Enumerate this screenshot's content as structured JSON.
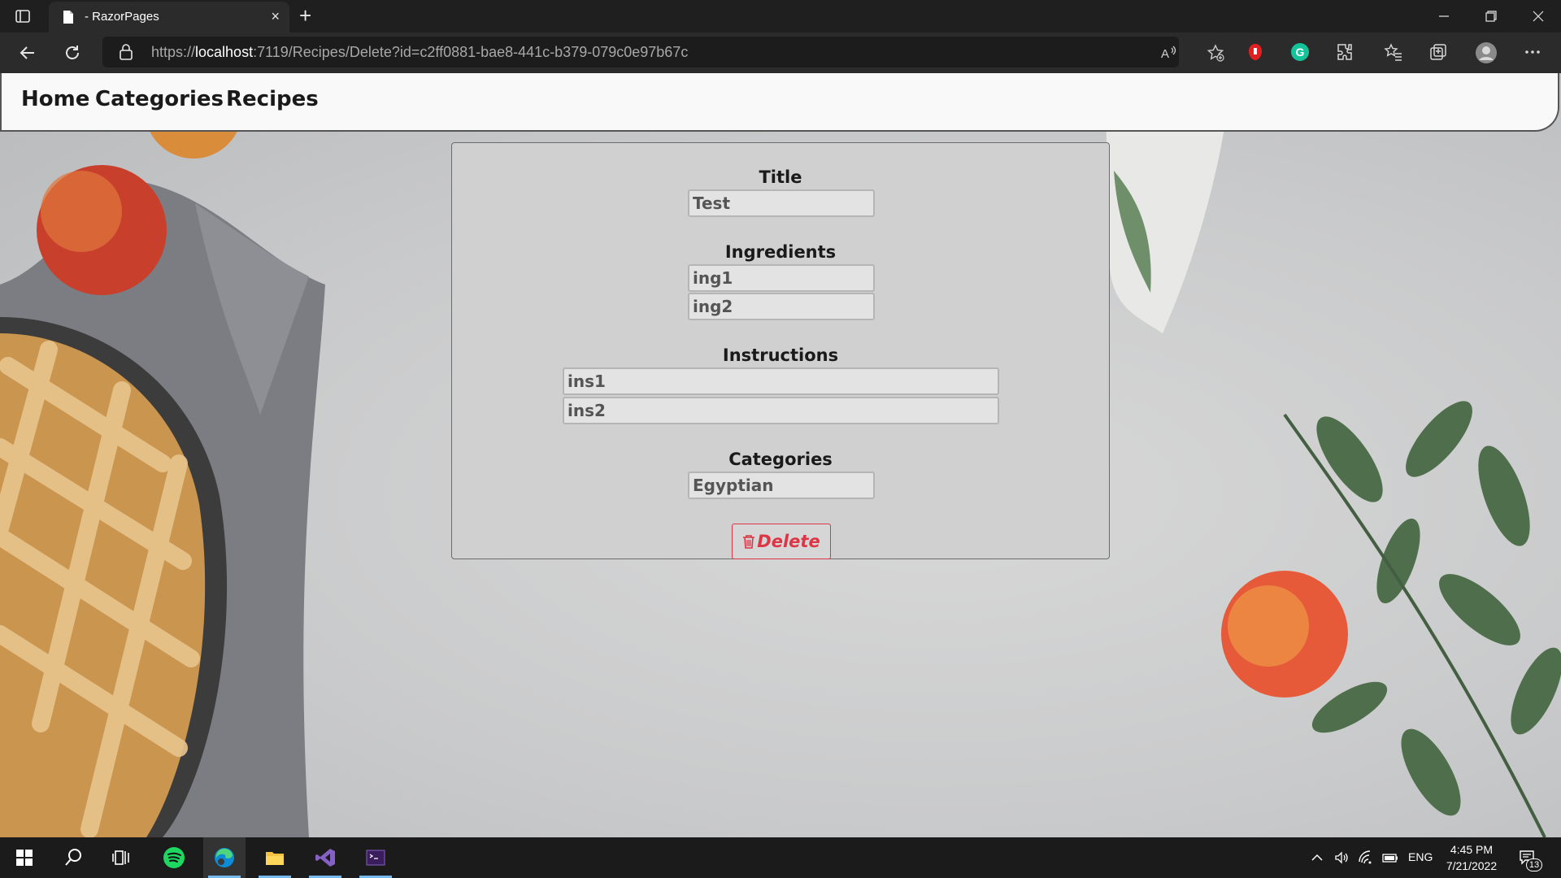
{
  "browser": {
    "tab_title": "- RazorPages",
    "tab_close": "×",
    "new_tab": "+",
    "url_prefix": "https://",
    "url_host": "localhost",
    "url_rest": ":7119/Recipes/Delete?id=c2ff0881-bae8-441c-b379-079c0e97b67c"
  },
  "nav": {
    "home": "Home",
    "categories": "Categories",
    "recipes": "Recipes"
  },
  "form": {
    "title_label": "Title",
    "title_value": "Test",
    "ingredients_label": "Ingredients",
    "ingredients": [
      "ing1",
      "ing2"
    ],
    "instructions_label": "Instructions",
    "instructions": [
      "ins1",
      "ins2"
    ],
    "categories_label": "Categories",
    "category_value": "Egyptian",
    "delete_label": "Delete"
  },
  "taskbar": {
    "language": "ENG",
    "time": "4:45 PM",
    "date": "7/21/2022",
    "notifications": "13"
  },
  "colors": {
    "danger": "#dc3545",
    "navbar_bg": "#f9f9f9",
    "card_bg": "#d0d0d0",
    "browser_dark": "#1f1f1f"
  }
}
